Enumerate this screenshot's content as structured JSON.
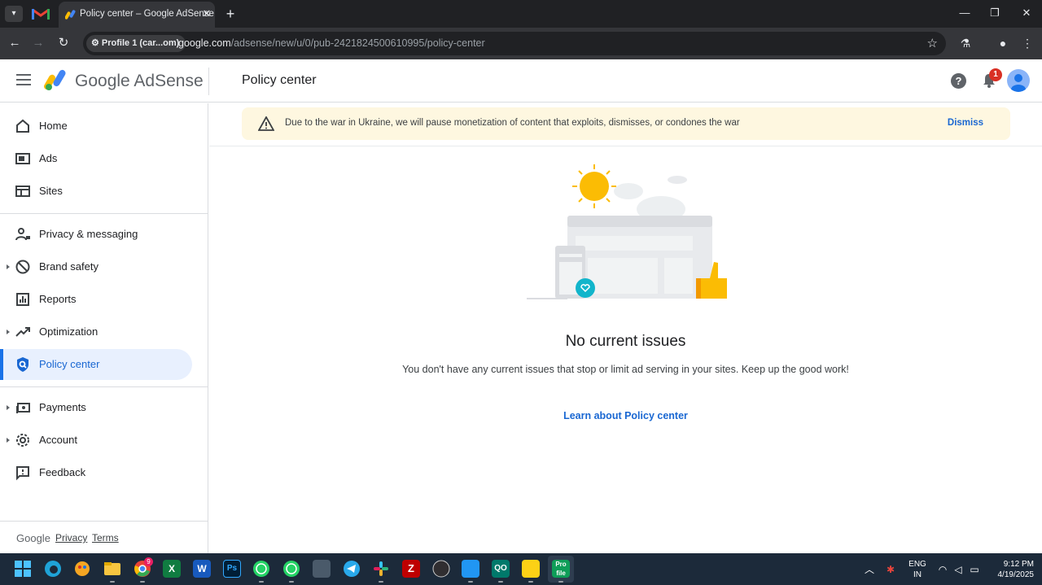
{
  "browser": {
    "tab_title": "Policy center – Google AdSense",
    "profile_chip": "Profile 1 (car...om)",
    "url_host": "google.com",
    "url_path": "/adsense/new/u/0/pub-2421824500610995/policy-center"
  },
  "appbar": {
    "brand": "Google AdSense",
    "page_title": "Policy center",
    "notification_count": "1"
  },
  "sidebar": {
    "items": [
      {
        "label": "Home"
      },
      {
        "label": "Ads"
      },
      {
        "label": "Sites"
      },
      {
        "label": "Privacy & messaging"
      },
      {
        "label": "Brand safety"
      },
      {
        "label": "Reports"
      },
      {
        "label": "Optimization"
      },
      {
        "label": "Policy center"
      },
      {
        "label": "Payments"
      },
      {
        "label": "Account"
      },
      {
        "label": "Feedback"
      }
    ],
    "footer": {
      "google": "Google",
      "privacy": "Privacy",
      "terms": "Terms"
    }
  },
  "banner": {
    "text": "Due to the war in Ukraine, we will pause monetization of content that exploits, dismisses, or condones the war",
    "dismiss": "Dismiss"
  },
  "empty_state": {
    "title": "No current issues",
    "description": "You don't have any current issues that stop or limit ad serving in your sites. Keep up the good work!",
    "link": "Learn about Policy center"
  },
  "taskbar": {
    "chrome_badge": "9",
    "lang_line1": "ENG",
    "lang_line2": "IN",
    "time": "9:12 PM",
    "date": "4/19/2025"
  },
  "colors": {
    "accent": "#1a73e8",
    "active_bg": "#e8f0fe",
    "banner_bg": "#fef7e0",
    "badge": "#d93025"
  }
}
